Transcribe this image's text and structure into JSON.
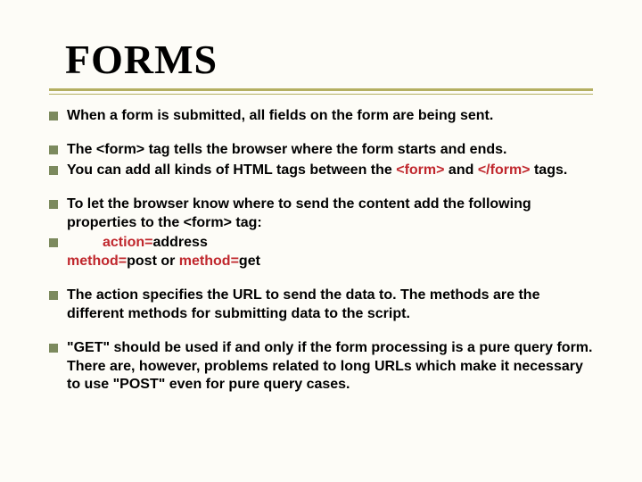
{
  "title": "FORMS",
  "bullets": {
    "b1": "When a form is submitted, all fields on the form are being sent.",
    "b2": "The <form> tag tells the browser where the form starts and ends.",
    "b3_a": "You can add all kinds of HTML tags between the ",
    "b3_b": "<form>",
    "b3_c": " and ",
    "b3_d": "</form>",
    "b3_e": " tags.",
    "b4": "To let the browser know where to send the content add the following properties to the <form> tag:",
    "b5_a": "action=",
    "b5_b": "address",
    "b5_c": "method=",
    "b5_d": "post or ",
    "b5_e": "method=",
    "b5_f": "get",
    "b6": "The action specifies the URL to send the data to. The methods are the different methods for submitting data to the script.",
    "b7": "\"GET\" should be used if and only if the form processing is a pure query form. There are, however, problems related to long URLs which make it necessary to use \"POST\" even for pure query cases."
  }
}
